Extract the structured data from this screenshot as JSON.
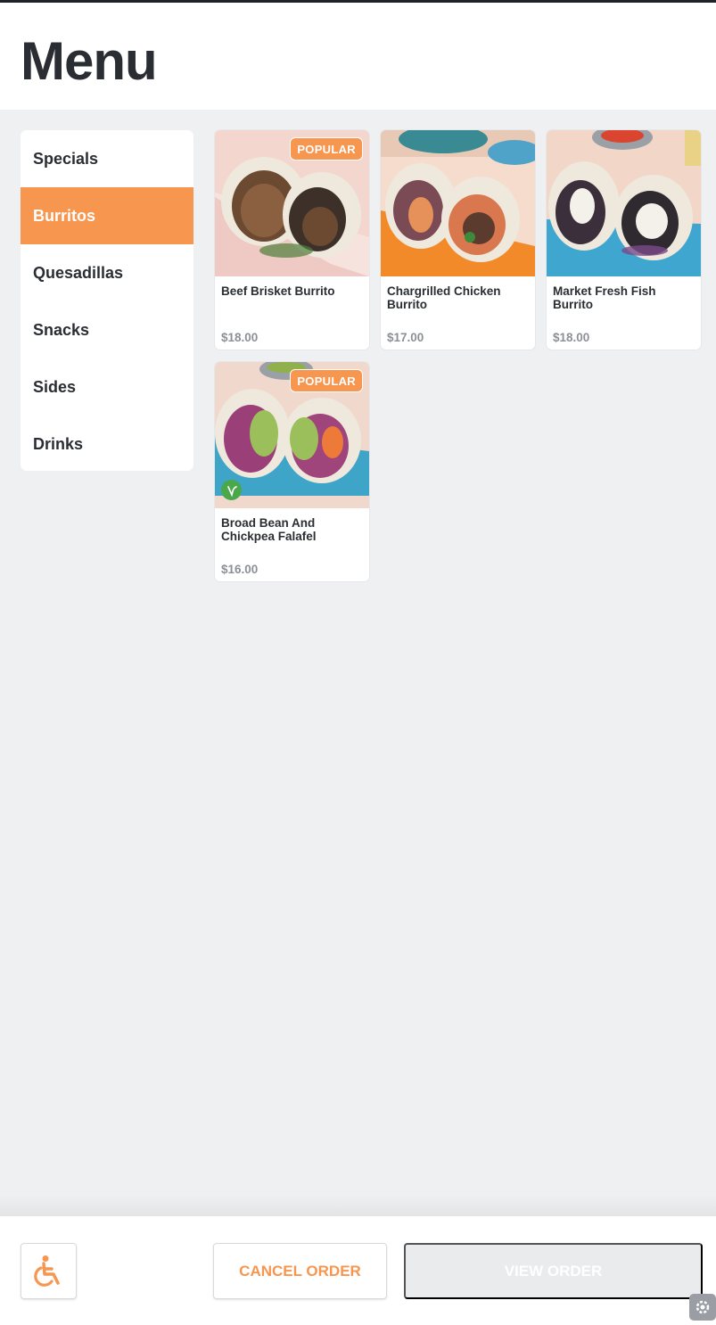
{
  "header": {
    "title": "Menu"
  },
  "categories": {
    "items": [
      {
        "label": "Specials"
      },
      {
        "label": "Burritos",
        "active": true
      },
      {
        "label": "Quesadillas"
      },
      {
        "label": "Snacks"
      },
      {
        "label": "Sides"
      },
      {
        "label": "Drinks"
      }
    ]
  },
  "products": [
    {
      "name": "Beef Brisket Burrito",
      "price": "$18.00",
      "badge": "POPULAR"
    },
    {
      "name": "Chargrilled Chicken Burrito",
      "price": "$17.00"
    },
    {
      "name": "Market Fresh Fish Burrito",
      "price": "$18.00"
    },
    {
      "name": "Broad Bean And Chickpea Falafel",
      "price": "$16.00",
      "badge": "POPULAR",
      "vegan_icon": "vegan-leaf-icon"
    }
  ],
  "footer": {
    "accessibility_icon": "wheelchair-icon",
    "cancel_label": "CANCEL ORDER",
    "view_label": "VIEW ORDER",
    "settings_icon": "gear-icon"
  },
  "colors": {
    "accent": "#f6964f",
    "background": "#eff0f2",
    "vegan_green": "#4aa84a"
  }
}
